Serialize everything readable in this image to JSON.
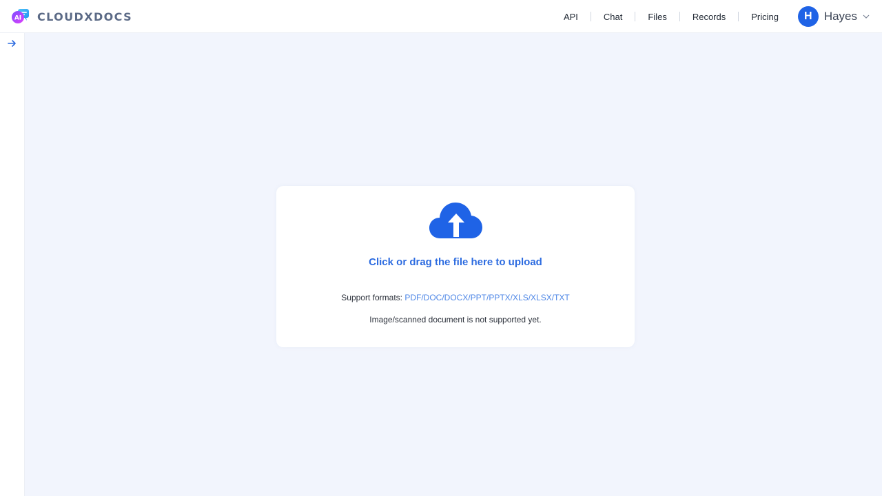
{
  "brand": {
    "name": "CLOUDXDOCS",
    "logo_icon": "ai-chat-logo-icon",
    "logo_text": "AI"
  },
  "nav": {
    "items": [
      "API",
      "Chat",
      "Files",
      "Records",
      "Pricing"
    ]
  },
  "user": {
    "initial": "H",
    "name": "Hayes",
    "menu_icon": "chevron-down-icon"
  },
  "sidebar": {
    "expand_icon": "arrow-right-icon"
  },
  "upload": {
    "icon": "cloud-upload-icon",
    "title": "Click or drag the file here to upload",
    "formats_label": "Support formats: ",
    "formats_value": "PDF/DOC/DOCX/PPT/PPTX/XLS/XLSX/TXT",
    "note": "Image/scanned document is not supported yet."
  },
  "colors": {
    "accent": "#1f63e6",
    "link": "#4d86e6",
    "background": "#f2f5fd"
  }
}
